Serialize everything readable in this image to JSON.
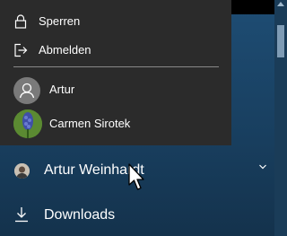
{
  "flyout": {
    "lock_label": "Sperren",
    "signout_label": "Abmelden",
    "users": [
      {
        "name": "Artur"
      },
      {
        "name": "Carmen Sirotek"
      }
    ]
  },
  "start_menu": {
    "account_label": "Artur Weinhardt",
    "downloads_label": "Downloads"
  },
  "colors": {
    "flyout_bg": "#2b2b2b",
    "start_bg": "#1e4d74",
    "text": "#ffffff"
  }
}
